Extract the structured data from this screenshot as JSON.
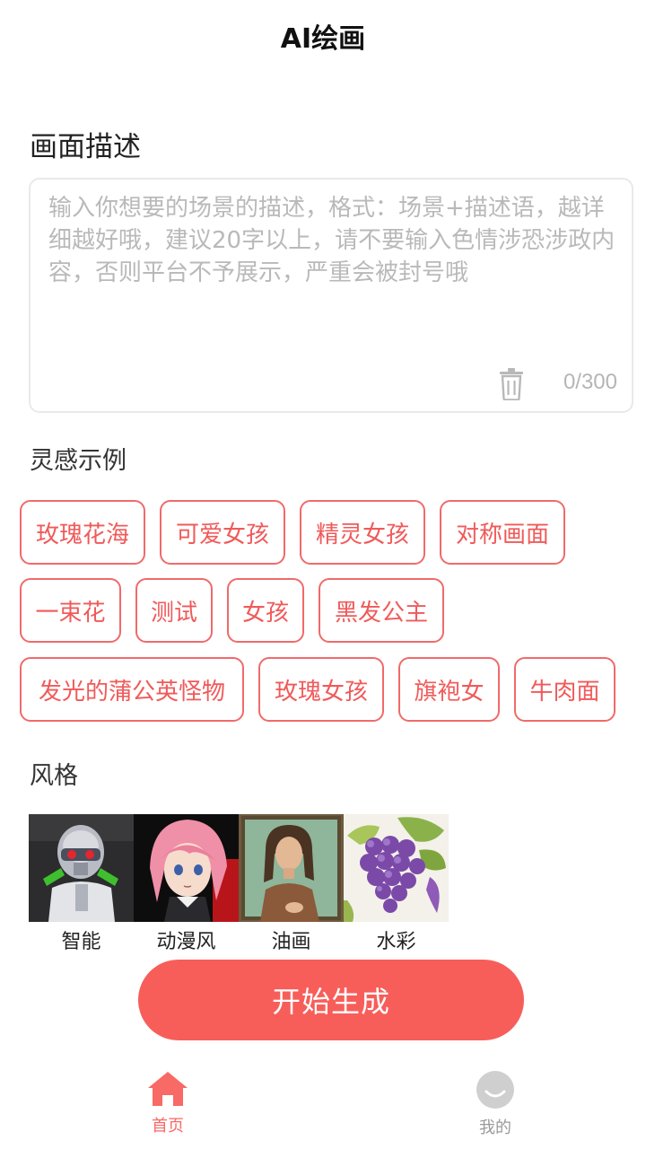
{
  "header": {
    "title": "AI绘画"
  },
  "description": {
    "title": "画面描述",
    "placeholder": "输入你想要的场景的描述，格式：场景+描述语，越详细越好哦，建议20字以上，请不要输入色情涉恐涉政内容，否则平台不予展示，严重会被封号哦",
    "value": "",
    "counter": "0/300"
  },
  "inspiration": {
    "title": "灵感示例",
    "rows": [
      [
        "玫瑰花海",
        "可爱女孩",
        "精灵女孩",
        "对称画面"
      ],
      [
        "一束花",
        "测试",
        "女孩",
        "黑发公主"
      ],
      [
        "发光的蒲公英怪物",
        "玫瑰女孩",
        "旗袍女",
        "牛肉面"
      ]
    ]
  },
  "style": {
    "title": "风格",
    "items": [
      "智能",
      "动漫风",
      "油画",
      "水彩"
    ]
  },
  "generate_label": "开始生成",
  "tabs": {
    "home": "首页",
    "mine": "我的"
  },
  "colors": {
    "accent": "#f75e5a",
    "tag_border": "#f06a6a",
    "tab_inactive": "#c8c8c8"
  }
}
